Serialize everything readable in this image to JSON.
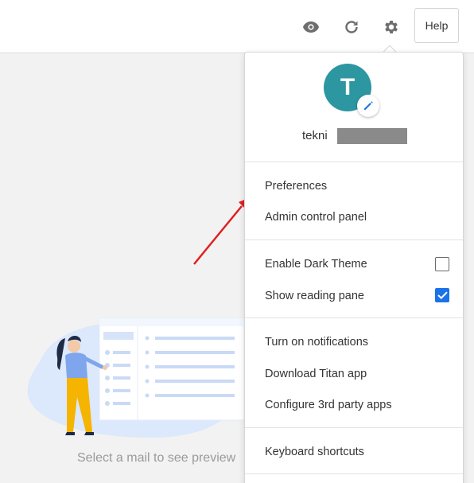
{
  "toolbar": {
    "view_icon": "eye-icon",
    "refresh_icon": "refresh-icon",
    "settings_icon": "gear-icon",
    "help_label": "Help"
  },
  "main": {
    "empty_message": "Select a mail to see preview"
  },
  "menu": {
    "avatar_initial": "T",
    "username": "tekni",
    "items": {
      "preferences": "Preferences",
      "admin_panel": "Admin control panel",
      "dark_theme": "Enable Dark Theme",
      "reading_pane": "Show reading pane",
      "notifications": "Turn on notifications",
      "download_app": "Download Titan app",
      "third_party": "Configure 3rd party apps",
      "shortcuts": "Keyboard shortcuts"
    },
    "dark_theme_checked": false,
    "reading_pane_checked": true
  },
  "colors": {
    "avatar": "#2c96a1",
    "checkbox_checked": "#1a73e8",
    "annotation_arrow": "#e02020"
  }
}
